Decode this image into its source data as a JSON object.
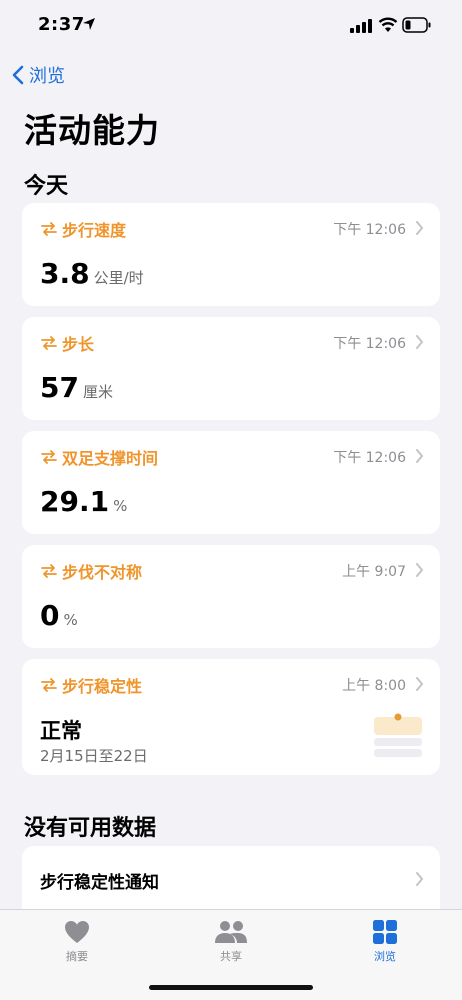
{
  "status_bar": {
    "time": "2:37"
  },
  "nav": {
    "back_label": "浏览"
  },
  "page": {
    "title": "活动能力"
  },
  "sections": {
    "today": "今天",
    "no_data": "没有可用数据"
  },
  "cards": [
    {
      "label": "步行速度",
      "time": "下午 12:06",
      "value": "3.8",
      "unit": "公里/时"
    },
    {
      "label": "步长",
      "time": "下午 12:06",
      "value": "57",
      "unit": "厘米"
    },
    {
      "label": "双足支撑时间",
      "time": "下午 12:06",
      "value": "29.1",
      "unit": "%"
    },
    {
      "label": "步伐不对称",
      "time": "上午 9:07",
      "value": "0",
      "unit": "%"
    }
  ],
  "stability": {
    "label": "步行稳定性",
    "time": "上午 8:00",
    "value": "正常",
    "date_range": "2月15日至22日"
  },
  "no_data_rows": [
    {
      "label": "步行稳定性通知"
    }
  ],
  "tab_bar": {
    "tabs": [
      {
        "label": "摘要"
      },
      {
        "label": "共享"
      },
      {
        "label": "浏览"
      }
    ],
    "active_index": 2
  },
  "colors": {
    "accent": "#1e6fd9",
    "mobility": "#f0952c",
    "background": "#f2f2f7"
  }
}
